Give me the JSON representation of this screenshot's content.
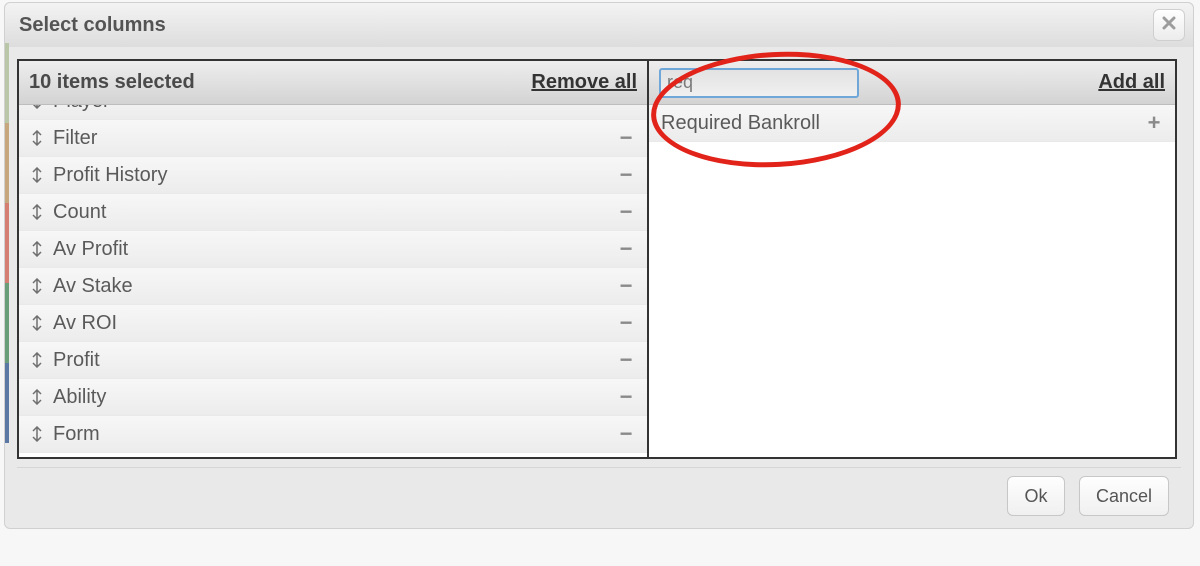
{
  "dialog": {
    "title": "Select columns"
  },
  "left_pane": {
    "count_label": "10 items selected",
    "remove_all_label": "Remove all",
    "items": [
      {
        "label": "Player"
      },
      {
        "label": "Filter"
      },
      {
        "label": "Profit History"
      },
      {
        "label": "Count"
      },
      {
        "label": "Av Profit"
      },
      {
        "label": "Av Stake"
      },
      {
        "label": "Av ROI"
      },
      {
        "label": "Profit"
      },
      {
        "label": "Ability"
      },
      {
        "label": "Form"
      }
    ]
  },
  "right_pane": {
    "search_value": "req",
    "add_all_label": "Add all",
    "items": [
      {
        "label": "Required Bankroll"
      }
    ]
  },
  "footer": {
    "ok_label": "Ok",
    "cancel_label": "Cancel"
  },
  "edge_colors": [
    "#b9c6a8",
    "#c7a77e",
    "#d47f72",
    "#6a9e7a",
    "#5a78a3"
  ]
}
